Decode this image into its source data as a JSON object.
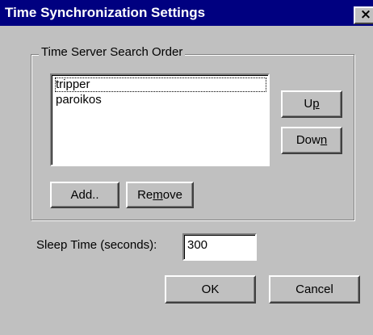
{
  "window": {
    "title": "Time Synchronization Settings",
    "close_glyph": "×"
  },
  "group": {
    "label": "Time Server Search Order",
    "servers": [
      "tripper",
      "paroikos"
    ],
    "focused_index": 0
  },
  "buttons": {
    "up": {
      "before": "U",
      "mnemonic": "p",
      "after": ""
    },
    "down": {
      "before": "Dow",
      "mnemonic": "n",
      "after": ""
    },
    "add": {
      "before": "Add..",
      "mnemonic": "",
      "after": ""
    },
    "remove": {
      "before": "Re",
      "mnemonic": "m",
      "after": "ove"
    },
    "ok": "OK",
    "cancel": "Cancel"
  },
  "sleep": {
    "label": "Sleep Time (seconds):",
    "value": "300"
  },
  "colors": {
    "titlebar": "#000080",
    "face": "#c0c0c0"
  }
}
